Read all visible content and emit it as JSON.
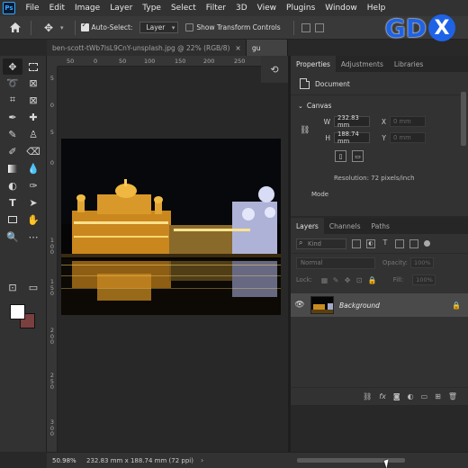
{
  "app": {
    "logo": "Ps"
  },
  "menu": [
    "File",
    "Edit",
    "Image",
    "Layer",
    "Type",
    "Select",
    "Filter",
    "3D",
    "View",
    "Plugins",
    "Window",
    "Help"
  ],
  "options": {
    "auto_select_label": "Auto-Select:",
    "auto_select_checked": true,
    "auto_select_value": "Layer",
    "transform_label": "Show Transform Controls",
    "transform_checked": false
  },
  "watermark": {
    "text": "GD",
    "x": "X"
  },
  "tabs": [
    {
      "label": "ben-scott-tWb7lsL9CnY-unsplash.jpg @ 22% (RGB/8)",
      "close": "×",
      "active": false
    },
    {
      "label": "gu",
      "active": true
    }
  ],
  "ruler": {
    "h": [
      "50",
      "0",
      "50",
      "100",
      "150",
      "200",
      "250"
    ],
    "v": [
      "5",
      "0",
      "5",
      "0",
      "1 0 0",
      "1 5 0",
      "2 0 0",
      "2 5 0",
      "3 0 0"
    ]
  },
  "properties": {
    "tabs": [
      "Properties",
      "Adjustments",
      "Libraries"
    ],
    "doc_label": "Document",
    "canvas_title": "Canvas",
    "w_label": "W",
    "w_value": "232.83 mm",
    "h_label": "H",
    "h_value": "188.74 mm",
    "x_label": "X",
    "x_value": "0 mm",
    "y_label": "Y",
    "y_value": "0 mm",
    "resolution": "Resolution: 72 pixels/inch",
    "mode": "Mode"
  },
  "layers": {
    "tabs": [
      "Layers",
      "Channels",
      "Paths"
    ],
    "kind_placeholder": "Kind",
    "blend": "Normal",
    "opacity_label": "Opacity:",
    "opacity_value": "100%",
    "lock_label": "Lock:",
    "fill_label": "Fill:",
    "fill_value": "100%",
    "items": [
      {
        "name": "Background",
        "visible": true,
        "locked": true
      }
    ]
  },
  "status": {
    "zoom": "50.98%",
    "doc_info": "232.83 mm x 188.74 mm (72 ppi)"
  },
  "colors": {
    "foreground": "#ffffff",
    "background": "#7a3f3f",
    "accent": "#31a8ff"
  }
}
